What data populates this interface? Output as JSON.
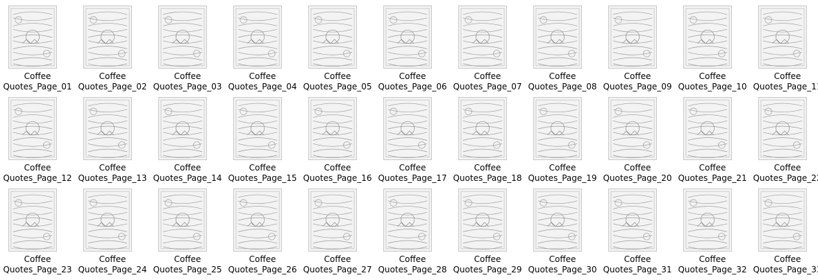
{
  "files": [
    {
      "line1": "Coffee",
      "line2": "Quotes_Page_01",
      "icon": "coloring-page-thumbnail"
    },
    {
      "line1": "Coffee",
      "line2": "Quotes_Page_02",
      "icon": "coloring-page-thumbnail"
    },
    {
      "line1": "Coffee",
      "line2": "Quotes_Page_03",
      "icon": "coloring-page-thumbnail"
    },
    {
      "line1": "Coffee",
      "line2": "Quotes_Page_04",
      "icon": "coloring-page-thumbnail"
    },
    {
      "line1": "Coffee",
      "line2": "Quotes_Page_05",
      "icon": "coloring-page-thumbnail"
    },
    {
      "line1": "Coffee",
      "line2": "Quotes_Page_06",
      "icon": "coloring-page-thumbnail"
    },
    {
      "line1": "Coffee",
      "line2": "Quotes_Page_07",
      "icon": "coloring-page-thumbnail"
    },
    {
      "line1": "Coffee",
      "line2": "Quotes_Page_08",
      "icon": "coloring-page-thumbnail"
    },
    {
      "line1": "Coffee",
      "line2": "Quotes_Page_09",
      "icon": "coloring-page-thumbnail"
    },
    {
      "line1": "Coffee",
      "line2": "Quotes_Page_10",
      "icon": "coloring-page-thumbnail"
    },
    {
      "line1": "Coffee",
      "line2": "Quotes_Page_11",
      "icon": "coloring-page-thumbnail"
    },
    {
      "line1": "Coffee",
      "line2": "Quotes_Page_12",
      "icon": "coloring-page-thumbnail"
    },
    {
      "line1": "Coffee",
      "line2": "Quotes_Page_13",
      "icon": "coloring-page-thumbnail"
    },
    {
      "line1": "Coffee",
      "line2": "Quotes_Page_14",
      "icon": "coloring-page-thumbnail"
    },
    {
      "line1": "Coffee",
      "line2": "Quotes_Page_15",
      "icon": "coloring-page-thumbnail"
    },
    {
      "line1": "Coffee",
      "line2": "Quotes_Page_16",
      "icon": "coloring-page-thumbnail"
    },
    {
      "line1": "Coffee",
      "line2": "Quotes_Page_17",
      "icon": "coloring-page-thumbnail"
    },
    {
      "line1": "Coffee",
      "line2": "Quotes_Page_18",
      "icon": "coloring-page-thumbnail"
    },
    {
      "line1": "Coffee",
      "line2": "Quotes_Page_19",
      "icon": "coloring-page-thumbnail"
    },
    {
      "line1": "Coffee",
      "line2": "Quotes_Page_20",
      "icon": "coloring-page-thumbnail"
    },
    {
      "line1": "Coffee",
      "line2": "Quotes_Page_21",
      "icon": "coloring-page-thumbnail"
    },
    {
      "line1": "Coffee",
      "line2": "Quotes_Page_22",
      "icon": "coloring-page-thumbnail"
    },
    {
      "line1": "Coffee",
      "line2": "Quotes_Page_23",
      "icon": "coloring-page-thumbnail"
    },
    {
      "line1": "Coffee",
      "line2": "Quotes_Page_24",
      "icon": "coloring-page-thumbnail"
    },
    {
      "line1": "Coffee",
      "line2": "Quotes_Page_25",
      "icon": "coloring-page-thumbnail"
    },
    {
      "line1": "Coffee",
      "line2": "Quotes_Page_26",
      "icon": "coloring-page-thumbnail"
    },
    {
      "line1": "Coffee",
      "line2": "Quotes_Page_27",
      "icon": "coloring-page-thumbnail"
    },
    {
      "line1": "Coffee",
      "line2": "Quotes_Page_28",
      "icon": "coloring-page-thumbnail"
    },
    {
      "line1": "Coffee",
      "line2": "Quotes_Page_29",
      "icon": "coloring-page-thumbnail"
    },
    {
      "line1": "Coffee",
      "line2": "Quotes_Page_30",
      "icon": "coloring-page-thumbnail"
    },
    {
      "line1": "Coffee",
      "line2": "Quotes_Page_31",
      "icon": "coloring-page-thumbnail"
    },
    {
      "line1": "Coffee",
      "line2": "Quotes_Page_32",
      "icon": "coloring-page-thumbnail"
    },
    {
      "line1": "Coffee",
      "line2": "Quotes_Page_33",
      "icon": "coloring-page-thumbnail"
    }
  ],
  "colors": {
    "background": "#ffffff",
    "label_text": "#000000",
    "thumb_bg": "#f3f3f3",
    "thumb_line": "#9a9a9a"
  }
}
